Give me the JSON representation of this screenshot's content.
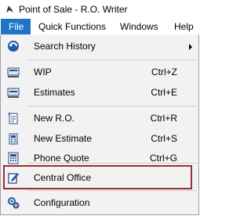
{
  "window": {
    "title": "Point of Sale - R.O. Writer"
  },
  "menubar": {
    "items": [
      {
        "label": "File"
      },
      {
        "label": "Quick Functions"
      },
      {
        "label": "Windows"
      },
      {
        "label": "Help"
      }
    ]
  },
  "file_menu": {
    "items": [
      {
        "label": "Search History",
        "shortcut": "",
        "icon": "search-history-icon"
      },
      {
        "label": "WIP",
        "shortcut": "Ctrl+Z",
        "icon": "wip-icon"
      },
      {
        "label": "Estimates",
        "shortcut": "Ctrl+E",
        "icon": "estimates-icon"
      },
      {
        "label": "New R.O.",
        "shortcut": "Ctrl+R",
        "icon": "new-ro-icon"
      },
      {
        "label": "New Estimate",
        "shortcut": "Ctrl+S",
        "icon": "new-estimate-icon"
      },
      {
        "label": "Phone Quote",
        "shortcut": "Ctrl+G",
        "icon": "phone-quote-icon"
      },
      {
        "label": "Central Office",
        "shortcut": "",
        "icon": "central-office-icon"
      },
      {
        "label": "Configuration",
        "shortcut": "",
        "icon": "configuration-icon"
      }
    ]
  },
  "colors": {
    "menu_active": "#1f74c7",
    "highlight_box": "#9b2e35",
    "menu_bg": "#f2f2f2"
  }
}
